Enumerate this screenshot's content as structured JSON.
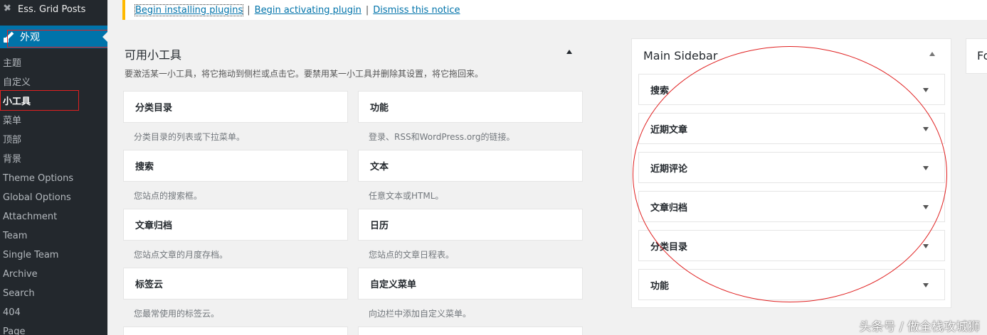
{
  "sidebar": {
    "top_item": "Ess. Grid Posts",
    "active_menu": "外观",
    "submenu": [
      "主题",
      "自定义",
      "小工具",
      "菜单",
      "顶部",
      "背景",
      "Theme Options",
      "Global Options",
      "Attachment",
      "Team",
      "Single Team",
      "Archive",
      "Search",
      "404",
      "Page"
    ],
    "current": "小工具"
  },
  "notice": {
    "link1": "Begin installing plugins",
    "link2": "Begin activating plugin",
    "link3": "Dismiss this notice",
    "sep": "|"
  },
  "available": {
    "title": "可用小工具",
    "desc": "要激活某一小工具，将它拖动到侧栏或点击它。要禁用某一小工具并删除其设置，将它拖回来。",
    "widgets": [
      {
        "name": "分类目录",
        "desc": "分类目录的列表或下拉菜单。"
      },
      {
        "name": "功能",
        "desc": "登录、RSS和WordPress.org的链接。"
      },
      {
        "name": "搜索",
        "desc": "您站点的搜索框。"
      },
      {
        "name": "文本",
        "desc": "任意文本或HTML。"
      },
      {
        "name": "文章归档",
        "desc": "您站点文章的月度存档。"
      },
      {
        "name": "日历",
        "desc": "您站点的文章日程表。"
      },
      {
        "name": "标签云",
        "desc": "您最常使用的标签云。"
      },
      {
        "name": "自定义菜单",
        "desc": "向边栏中添加自定义菜单。"
      }
    ]
  },
  "main_sidebar": {
    "title": "Main Sidebar",
    "items": [
      "搜索",
      "近期文章",
      "近期评论",
      "文章归档",
      "分类目录",
      "功能"
    ]
  },
  "next_panel": {
    "title_partial": "Fo"
  },
  "watermark": "头条号 / 做全栈攻城狮",
  "colors": {
    "sidebar_bg": "#23282d",
    "accent": "#0073aa",
    "notice_border": "#ffb900",
    "annotation": "#e02020"
  }
}
